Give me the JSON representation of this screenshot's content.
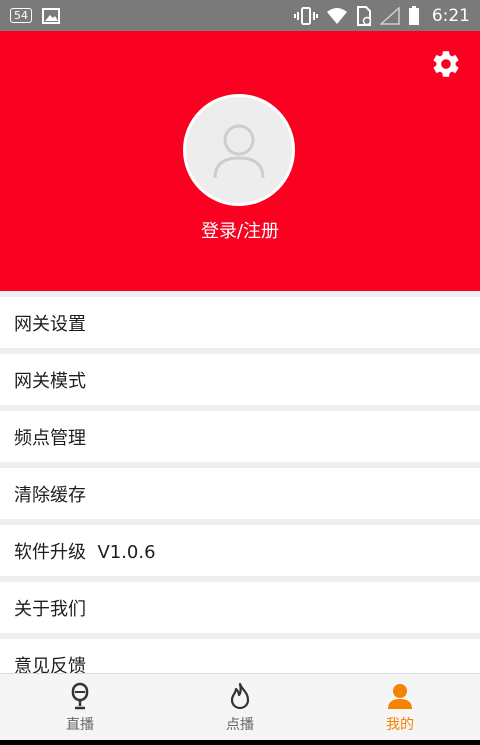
{
  "status_bar": {
    "notification_badge": "54",
    "time": "6:21"
  },
  "header": {
    "login_label": "登录/注册",
    "accent_color": "#fa0021"
  },
  "menu": {
    "items": [
      {
        "label": "网关设置"
      },
      {
        "label": "网关模式"
      },
      {
        "label": "频点管理"
      },
      {
        "label": "清除缓存"
      },
      {
        "label": "软件升级  V1.0.6"
      },
      {
        "label": "关于我们"
      },
      {
        "label": "意见反馈"
      }
    ]
  },
  "tabbar": {
    "tabs": [
      {
        "label": "直播",
        "icon": "microphone-icon"
      },
      {
        "label": "点播",
        "icon": "flame-icon"
      },
      {
        "label": "我的",
        "icon": "user-icon",
        "active": true
      }
    ],
    "active_color": "#f58200"
  }
}
